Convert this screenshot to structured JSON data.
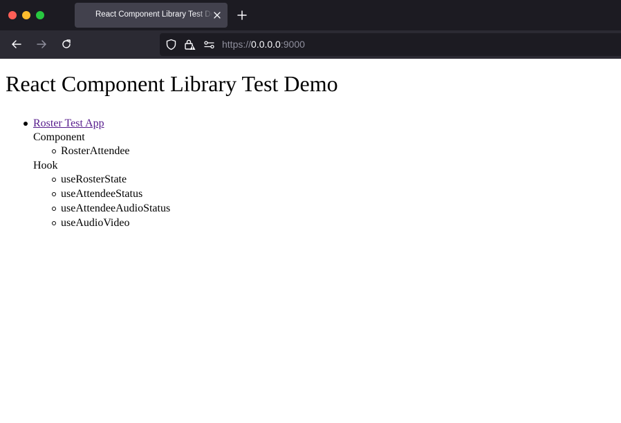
{
  "browser": {
    "tab": {
      "title": "React Component Library Test Demo"
    },
    "url": {
      "scheme": "https://",
      "host": "0.0.0.0",
      "port": ":9000"
    }
  },
  "page": {
    "title": "React Component Library Test Demo",
    "apps": [
      {
        "link_label": "Roster Test App",
        "sections": [
          {
            "label": "Component",
            "items": [
              "RosterAttendee"
            ]
          },
          {
            "label": "Hook",
            "items": [
              "useRosterState",
              "useAttendeeStatus",
              "useAttendeeAudioStatus",
              "useAudioVideo"
            ]
          }
        ]
      }
    ]
  },
  "colors": {
    "tabbar_bg": "#1c1b22",
    "navbar_bg": "#2b2a33",
    "active_tab_bg": "#42414d",
    "visited_link": "#551a8b"
  },
  "icons": {
    "traffic_lights": [
      "close-window-icon",
      "minimize-window-icon",
      "zoom-window-icon"
    ],
    "nav": [
      "back-arrow-icon",
      "forward-arrow-icon",
      "reload-icon"
    ],
    "urlbar": [
      "shield-icon",
      "lock-warning-icon",
      "permissions-icon"
    ]
  }
}
